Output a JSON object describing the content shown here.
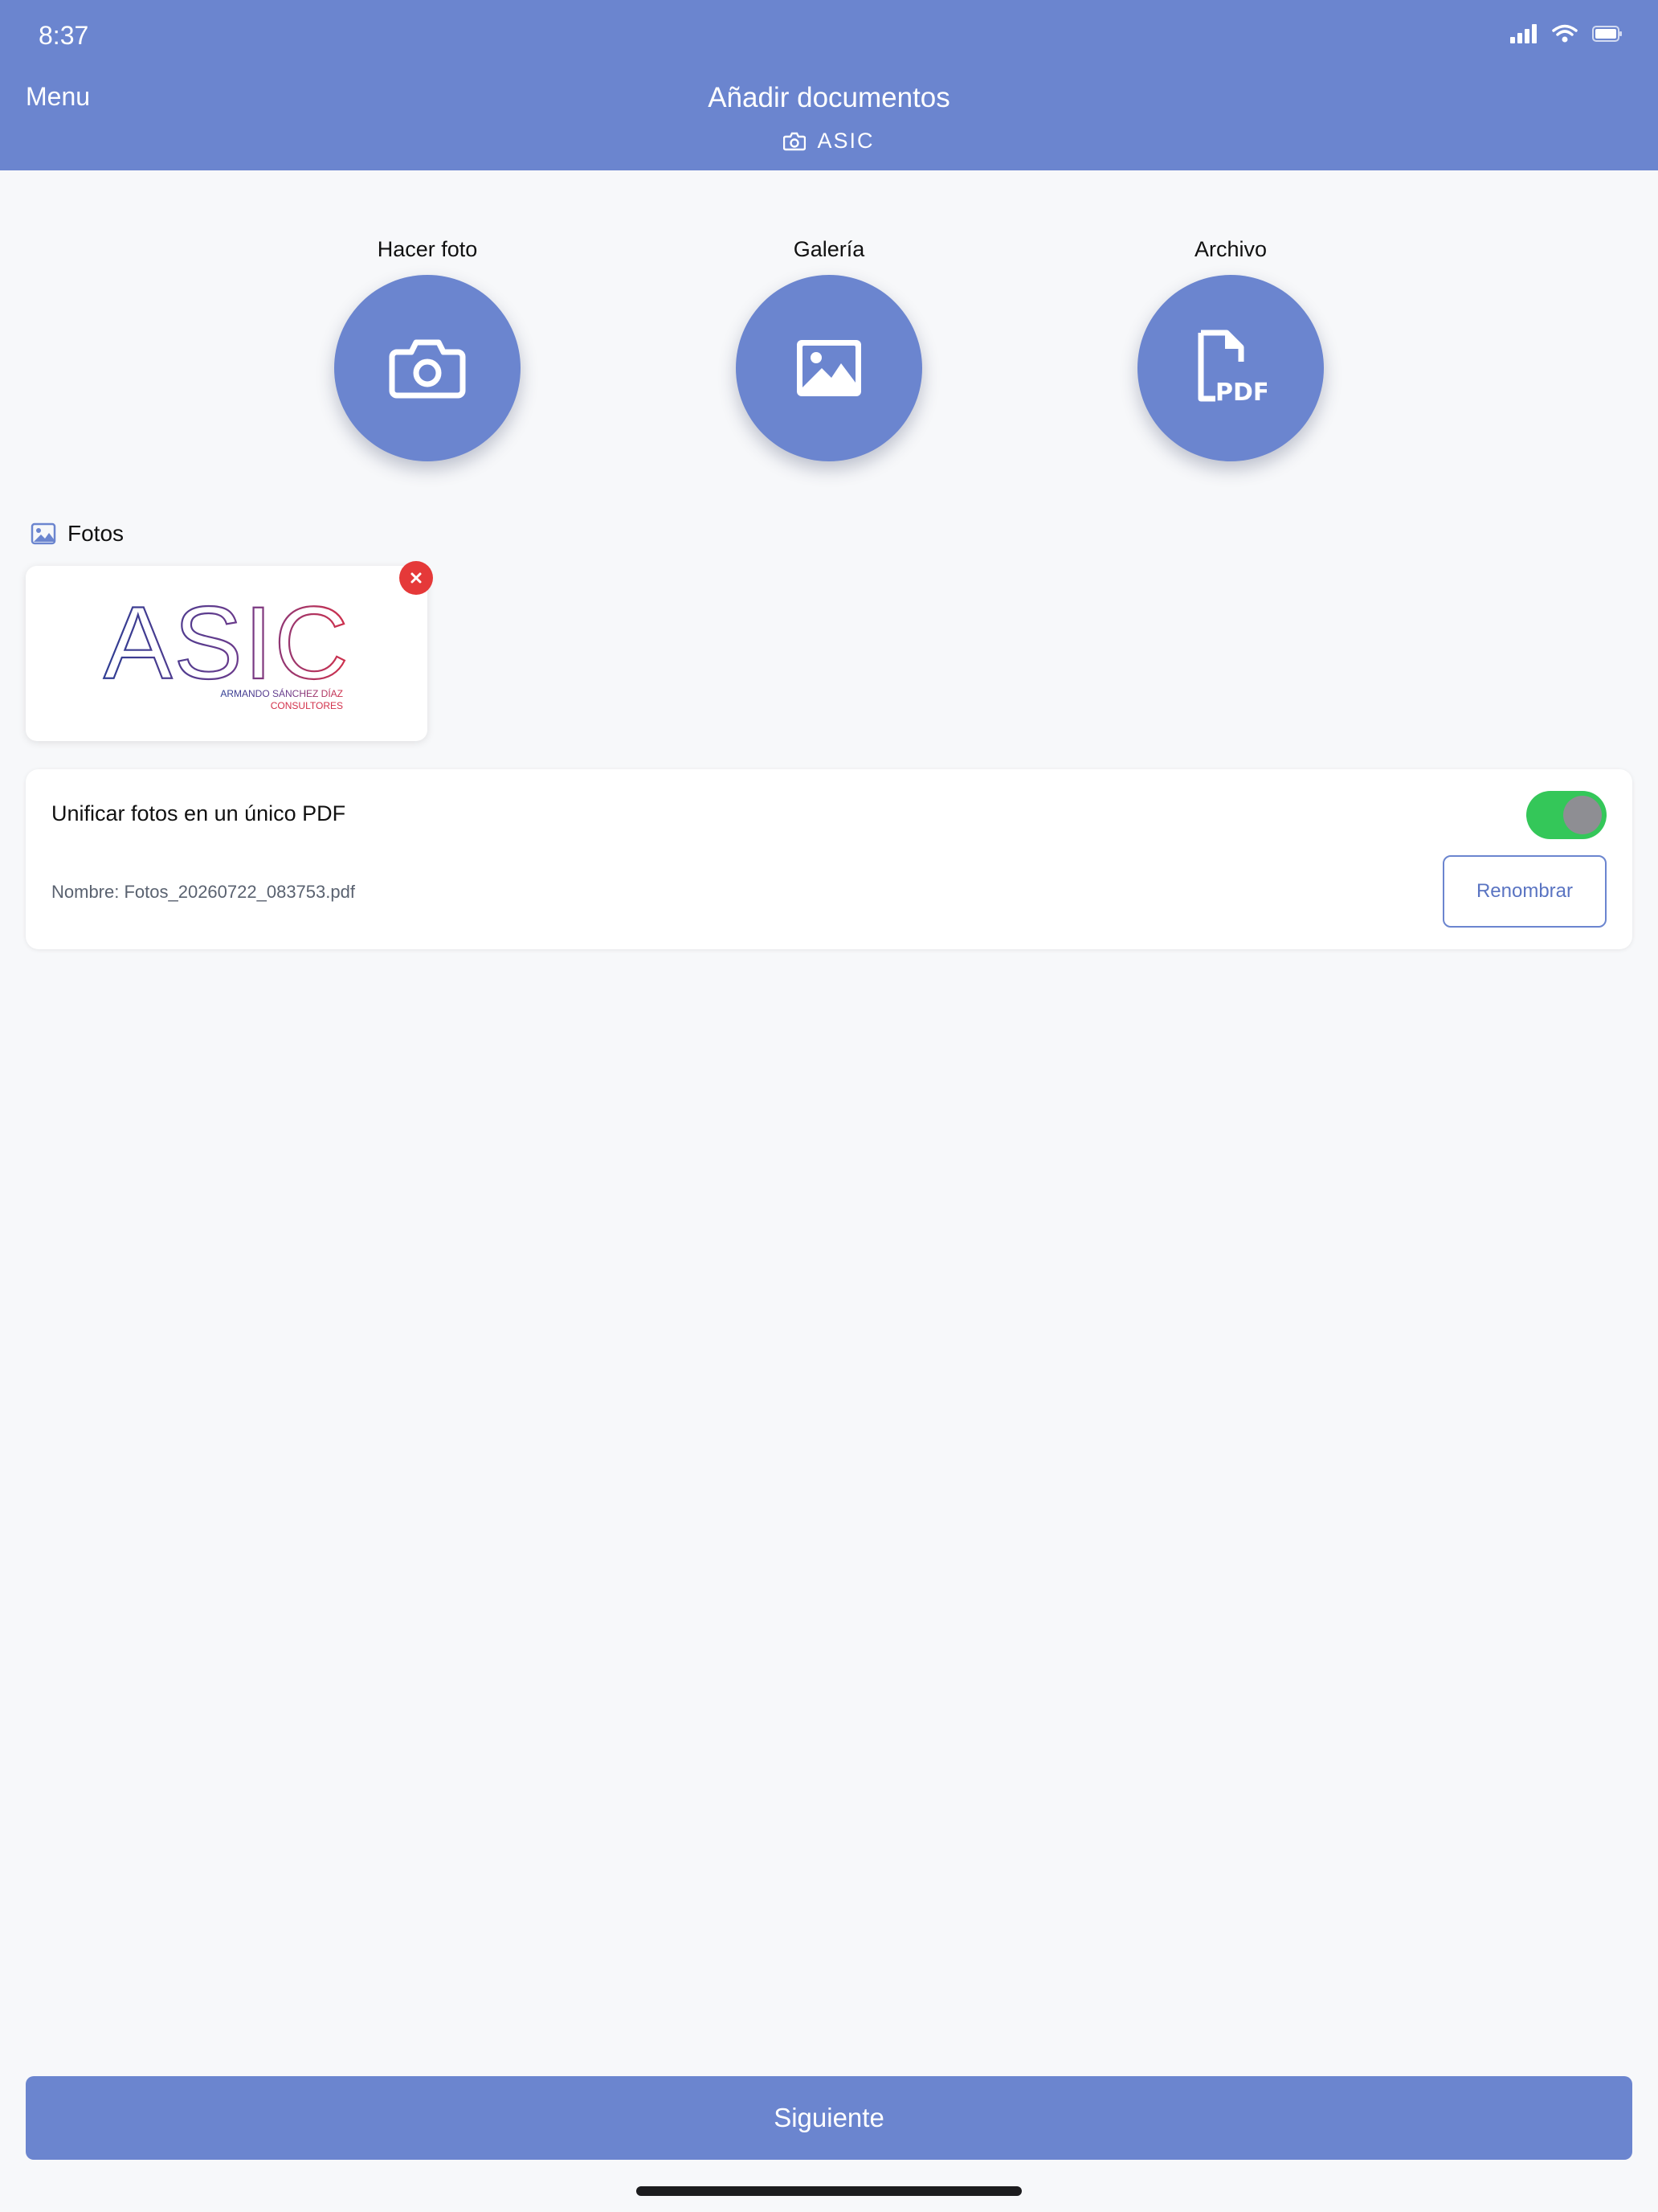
{
  "status_bar": {
    "time": "8:37"
  },
  "header": {
    "menu_label": "Menu",
    "title": "Añadir documentos",
    "subtitle": "ASIC"
  },
  "actions": [
    {
      "label": "Hacer foto",
      "icon": "camera-icon"
    },
    {
      "label": "Galería",
      "icon": "image-icon"
    },
    {
      "label": "Archivo",
      "icon": "pdf-file-icon"
    }
  ],
  "photos": {
    "title": "Fotos",
    "items": [
      {
        "logo_text": "ASIC",
        "logo_sub1": "ARMANDO SÁNCHEZ DÍAZ",
        "logo_sub2": "CONSULTORES"
      }
    ]
  },
  "merge": {
    "label": "Unificar fotos en un único PDF",
    "enabled": true,
    "filename": "Nombre: Fotos_20260722_083753.pdf",
    "rename_label": "Renombrar"
  },
  "footer": {
    "next_label": "Siguiente"
  },
  "colors": {
    "primary": "#6b85cf",
    "toggle_on": "#34c759",
    "delete": "#e53939",
    "background": "#f7f8fa"
  }
}
